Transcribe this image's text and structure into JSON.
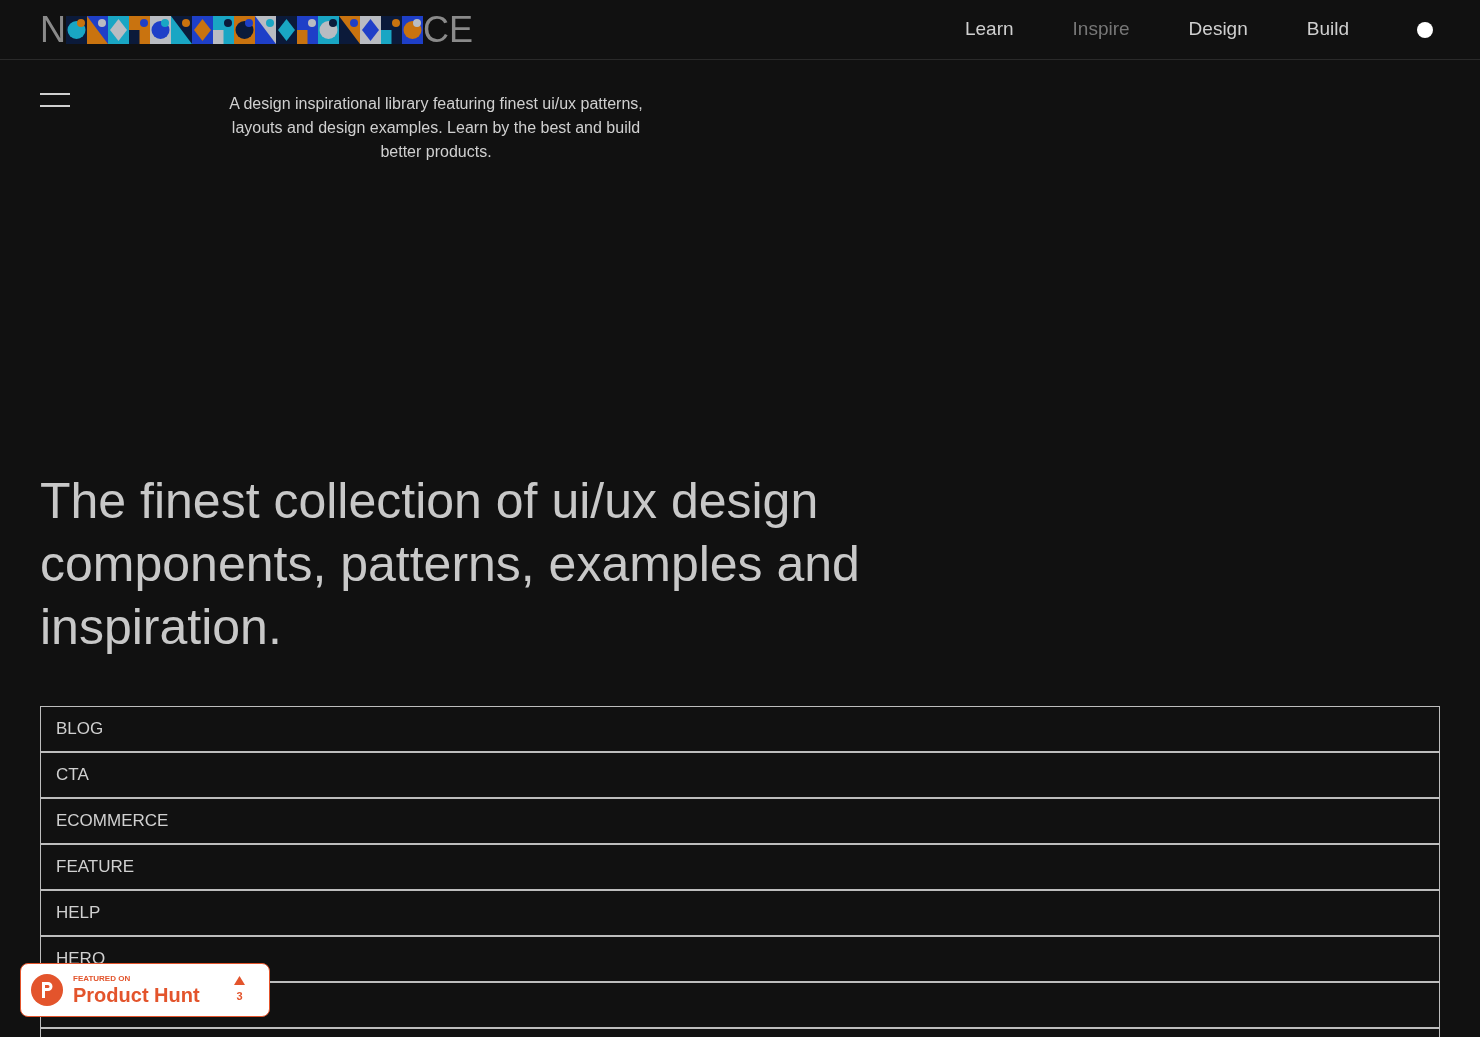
{
  "logo": {
    "start": "N",
    "end": "CE"
  },
  "nav": [
    {
      "label": "Learn",
      "selected": false
    },
    {
      "label": "Inspire",
      "selected": true
    },
    {
      "label": "Design",
      "selected": false
    },
    {
      "label": "Build",
      "selected": false
    }
  ],
  "tagline": "A design inspirational library featuring finest ui/ux patterns, layouts and design examples. Learn by the best and build better products.",
  "headline": "The finest collection of ui/ux design components, patterns, examples and inspiration.",
  "categories": [
    "BLOG",
    "CTA",
    "ECOMMERCE",
    "FEATURE",
    "HELP",
    "HERO"
  ],
  "badge": {
    "caption": "FEATURED ON",
    "name": "Product Hunt",
    "votes": "3"
  }
}
